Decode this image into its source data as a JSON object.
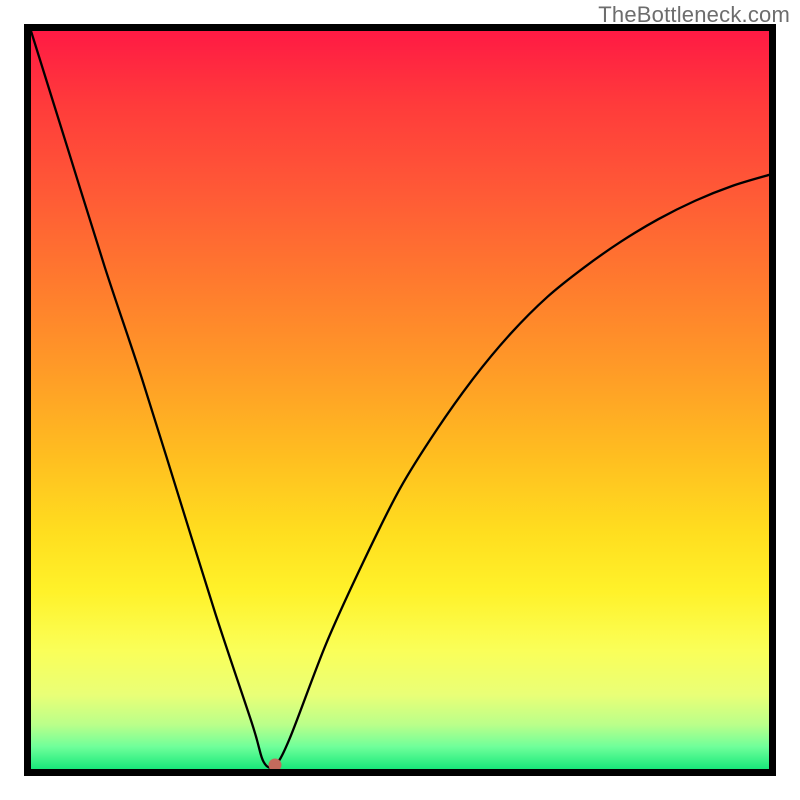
{
  "watermark": {
    "text": "TheBottleneck.com"
  },
  "colors": {
    "frame": "#000000",
    "curve": "#000000",
    "marker": "#c46a5c",
    "gradient_top": "#ff1a44",
    "gradient_mid": "#ffde1f",
    "gradient_bottom": "#18e87a"
  },
  "chart_data": {
    "type": "line",
    "title": "",
    "xlabel": "",
    "ylabel": "",
    "xlim": [
      0,
      100
    ],
    "ylim": [
      0,
      100
    ],
    "grid": false,
    "series": [
      {
        "name": "bottleneck-curve",
        "x": [
          0,
          5,
          10,
          15,
          20,
          25,
          30,
          31.5,
          33,
          35,
          40,
          45,
          50,
          55,
          60,
          65,
          70,
          75,
          80,
          85,
          90,
          95,
          100
        ],
        "y": [
          100,
          84,
          68,
          53,
          37,
          21,
          6,
          1.0,
          0.5,
          4,
          17,
          28,
          38,
          46,
          53,
          59,
          64,
          68,
          71.5,
          74.5,
          77,
          79,
          80.5
        ]
      }
    ],
    "annotations": [
      {
        "name": "min-marker",
        "x": 33,
        "y": 0.5
      }
    ],
    "background_gradient": {
      "direction": "vertical",
      "stops": [
        {
          "pos": 0.0,
          "color": "#ff1a44"
        },
        {
          "pos": 0.5,
          "color": "#ffbf20"
        },
        {
          "pos": 0.78,
          "color": "#fff22a"
        },
        {
          "pos": 1.0,
          "color": "#18e87a"
        }
      ]
    }
  }
}
